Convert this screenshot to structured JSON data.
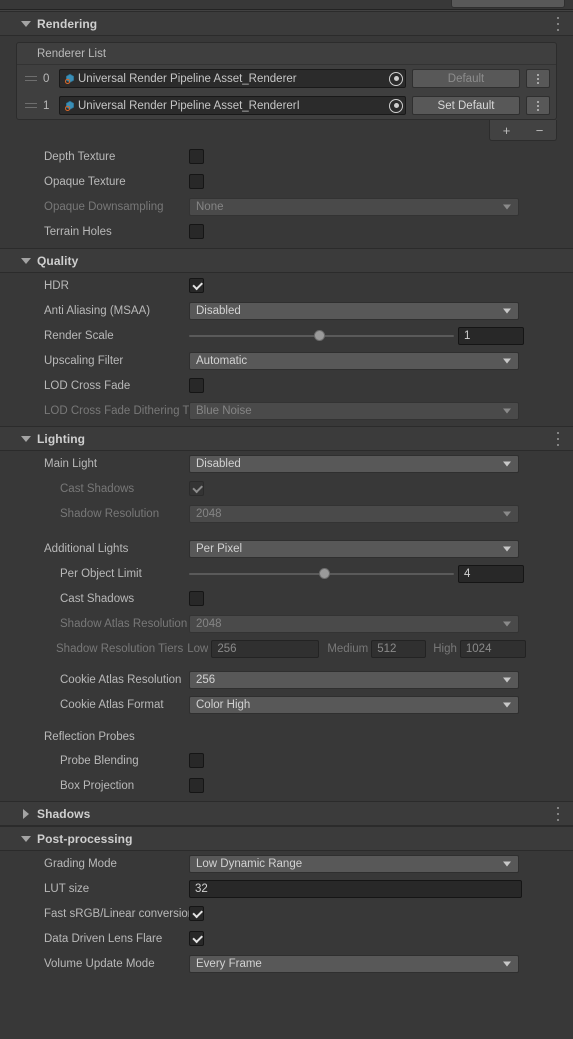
{
  "sections": {
    "rendering": {
      "title": "Rendering",
      "expanded": true,
      "has_menu": true
    },
    "quality": {
      "title": "Quality",
      "expanded": true,
      "has_menu": false
    },
    "lighting": {
      "title": "Lighting",
      "expanded": true,
      "has_menu": true
    },
    "shadows": {
      "title": "Shadows",
      "expanded": false,
      "has_menu": true
    },
    "post": {
      "title": "Post-processing",
      "expanded": true,
      "has_menu": false
    }
  },
  "rendering": {
    "renderer_list_label": "Renderer List",
    "rows": [
      {
        "index": "0",
        "asset": "Universal Render Pipeline Asset_Renderer",
        "button": "Default",
        "button_enabled": false
      },
      {
        "index": "1",
        "asset": "Universal Render Pipeline Asset_RendererI",
        "button": "Set Default",
        "button_enabled": true
      }
    ],
    "add_label": "+",
    "remove_label": "−",
    "fields": [
      {
        "label": "Depth Texture",
        "type": "checkbox",
        "value": false,
        "dim": false
      },
      {
        "label": "Opaque Texture",
        "type": "checkbox",
        "value": false,
        "dim": false
      },
      {
        "label": "Opaque Downsampling",
        "type": "dropdown",
        "value": "None",
        "dim": true
      },
      {
        "label": "Terrain Holes",
        "type": "checkbox",
        "value": false,
        "dim": false
      }
    ]
  },
  "quality": {
    "fields": [
      {
        "label": "HDR",
        "type": "checkbox",
        "value": true,
        "dim": false
      },
      {
        "label": "Anti Aliasing (MSAA)",
        "type": "dropdown",
        "value": "Disabled",
        "dim": false
      },
      {
        "label": "Render Scale",
        "type": "slider",
        "value": "1",
        "fill": 0.47,
        "dim": false
      },
      {
        "label": "Upscaling Filter",
        "type": "dropdown",
        "value": "Automatic",
        "dim": false
      },
      {
        "label": "LOD Cross Fade",
        "type": "checkbox",
        "value": false,
        "dim": false
      },
      {
        "label": "LOD Cross Fade Dithering Type",
        "type": "dropdown",
        "value": "Blue Noise",
        "dim": true
      }
    ]
  },
  "lighting": {
    "main_light": {
      "label": "Main Light",
      "value": "Disabled"
    },
    "main_cast_shadows": {
      "label": "Cast Shadows",
      "value": true
    },
    "main_shadow_resolution": {
      "label": "Shadow Resolution",
      "value": "2048"
    },
    "additional_lights": {
      "label": "Additional Lights",
      "value": "Per Pixel"
    },
    "per_object_limit": {
      "label": "Per Object Limit",
      "value": "4",
      "fill": 0.49
    },
    "add_cast_shadows": {
      "label": "Cast Shadows",
      "value": false
    },
    "shadow_atlas_resolution": {
      "label": "Shadow Atlas Resolution",
      "value": "2048"
    },
    "shadow_tier": {
      "label": "Shadow Resolution Tiers",
      "low_label": "Low",
      "low_value": "256",
      "medium_label": "Medium",
      "medium_value": "512",
      "high_label": "High",
      "high_value": "1024"
    },
    "cookie_atlas_resolution": {
      "label": "Cookie Atlas Resolution",
      "value": "256"
    },
    "cookie_atlas_format": {
      "label": "Cookie Atlas Format",
      "value": "Color High"
    },
    "reflection_probes_label": "Reflection Probes",
    "probe_blending": {
      "label": "Probe Blending",
      "value": false
    },
    "box_projection": {
      "label": "Box Projection",
      "value": false
    }
  },
  "post": {
    "grading_mode": {
      "label": "Grading Mode",
      "value": "Low Dynamic Range"
    },
    "lut_size": {
      "label": "LUT size",
      "value": "32"
    },
    "fast_srgb": {
      "label": "Fast sRGB/Linear conversions",
      "value": true
    },
    "lens_flare": {
      "label": "Data Driven Lens Flare",
      "value": true
    },
    "volume_update": {
      "label": "Volume Update Mode",
      "value": "Every Frame"
    }
  },
  "colors": {
    "background": "#383838",
    "section_header": "#3b3b3b",
    "dropdown": "#585858",
    "field_dark": "#282828",
    "text": "#b9b9b9",
    "text_dim": "#787878"
  }
}
